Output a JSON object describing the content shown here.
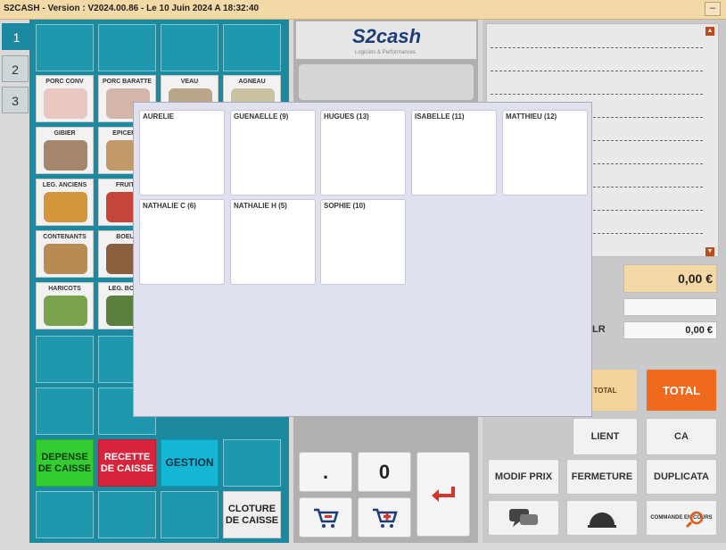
{
  "window": {
    "title": "S2CASH - Version : V2024.00.86 - Le 10 Juin 2024 A 18:32:40",
    "minimize_label": "–"
  },
  "page_tabs": [
    "1",
    "2",
    "3"
  ],
  "products": [
    {
      "label": "PORC CONV",
      "color": "#e8c8c0"
    },
    {
      "label": "PORC BARATTE",
      "color": "#d3b6a8"
    },
    {
      "label": "VEAU",
      "color": "#b9a588"
    },
    {
      "label": "AGNEAU",
      "color": "#c8c2a0"
    },
    {
      "label": "GIBIER",
      "color": "#a4866a"
    },
    {
      "label": "EPICERIE",
      "color": "#c29a6a"
    },
    {
      "label": "LEG. ANCIENS",
      "color": "#d4963a"
    },
    {
      "label": "FRUITS",
      "color": "#c5453a"
    },
    {
      "label": "CONTENANTS",
      "color": "#b98b54"
    },
    {
      "label": "BOEUF",
      "color": "#8a5f3e"
    },
    {
      "label": "HARICOTS",
      "color": "#7aa34f"
    },
    {
      "label": "LEG. BOTTE",
      "color": "#5b7f3f"
    }
  ],
  "actions": {
    "depense": "DEPENSE DE CAISSE",
    "recette": "RECETTE DE CAISSE",
    "gestion": "GESTION",
    "cloture": "CLOTURE DE CAISSE"
  },
  "logo": {
    "brand": "S2cash",
    "subtitle": "Logiciels & Performances"
  },
  "keypad": {
    "dot": ".",
    "zero": "0",
    "enter_icon": "enter-arrow-icon"
  },
  "totals": {
    "main_amount": "0,00 €",
    "rendu_amount": "0,00 €",
    "rendu_label": "LR"
  },
  "right_buttons": {
    "total": "TOTAL",
    "client": "LIENT",
    "ca": "CA",
    "modif_prix": "MODIF PRIX",
    "fermeture": "FERMETURE",
    "duplicata": "DUPLICATA",
    "commande": "COMMANDE EN COURS",
    "total_bag": "TOTAL"
  },
  "sellers": [
    "AURELIE",
    "GUENAELLE (9)",
    "HUGUES (13)",
    "ISABELLE (11)",
    "MATTHIEU (12)",
    "NATHALIE C (6)",
    "NATHALIE H (5)",
    "SOPHIE (10)"
  ],
  "colors": {
    "panel_teal": "#1b8aa0",
    "depense_green": "#33cc33",
    "recette_red": "#d8243a",
    "gestion_cyan": "#14b6d6",
    "total_orange": "#f06a1e",
    "amount_bg": "#f6d7a6"
  }
}
